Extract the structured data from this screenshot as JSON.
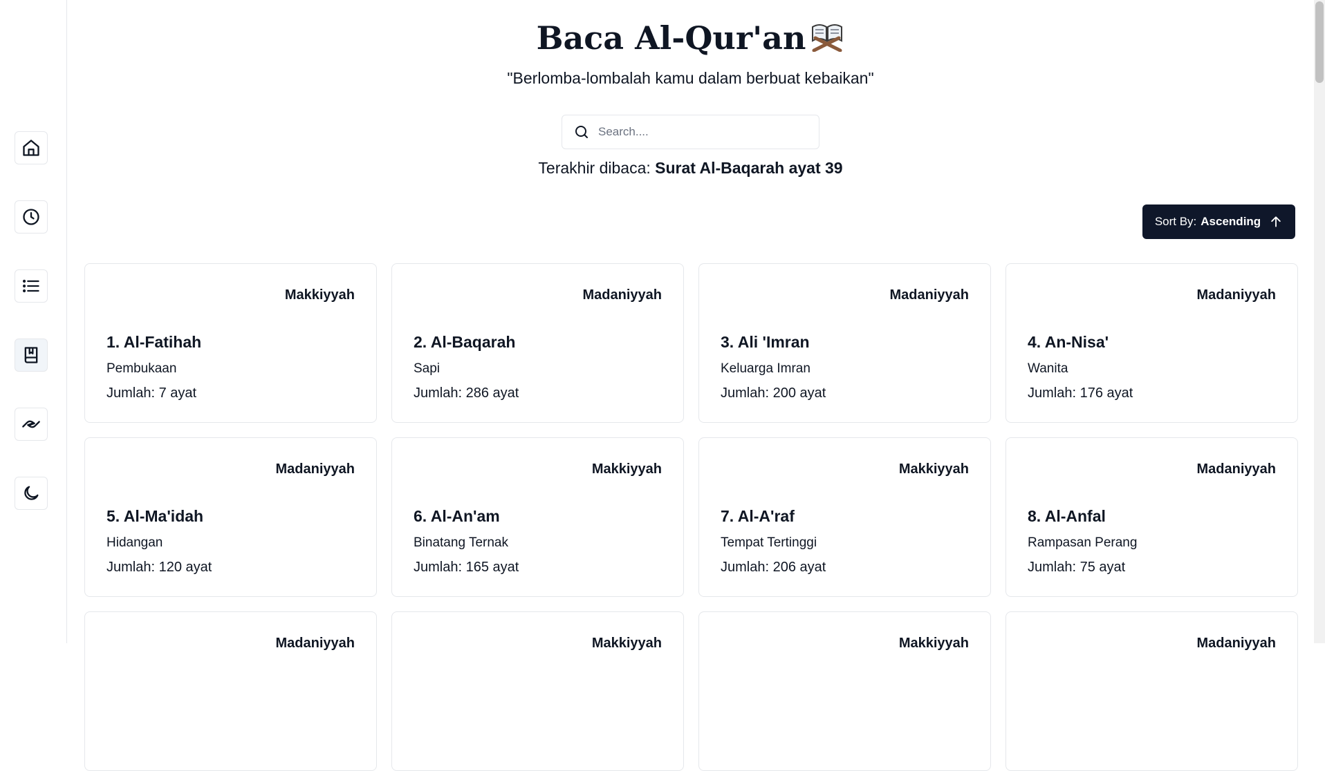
{
  "header": {
    "title": "Baca Al-Qur'an",
    "subtitle": "\"Berlomba-lombalah kamu dalam berbuat kebaikan\""
  },
  "search": {
    "placeholder": "Search...."
  },
  "last_read": {
    "label": "Terakhir dibaca:",
    "value": "Surat Al-Baqarah ayat 39"
  },
  "sort": {
    "label": "Sort By:",
    "value": "Ascending"
  },
  "sidebar": {
    "items": [
      {
        "name": "home",
        "icon": "home-icon"
      },
      {
        "name": "history",
        "icon": "clock-icon"
      },
      {
        "name": "list",
        "icon": "list-icon"
      },
      {
        "name": "quran",
        "icon": "book-icon",
        "active": true
      },
      {
        "name": "prayer",
        "icon": "praying-hands-icon"
      },
      {
        "name": "theme",
        "icon": "moon-icon"
      }
    ]
  },
  "surahs": [
    {
      "type": "Makkiyyah",
      "name": "1. Al-Fatihah",
      "meaning": "Pembukaan",
      "count": "Jumlah: 7 ayat"
    },
    {
      "type": "Madaniyyah",
      "name": "2. Al-Baqarah",
      "meaning": "Sapi",
      "count": "Jumlah: 286 ayat"
    },
    {
      "type": "Madaniyyah",
      "name": "3. Ali 'Imran",
      "meaning": "Keluarga Imran",
      "count": "Jumlah: 200 ayat"
    },
    {
      "type": "Madaniyyah",
      "name": "4. An-Nisa'",
      "meaning": "Wanita",
      "count": "Jumlah: 176 ayat"
    },
    {
      "type": "Madaniyyah",
      "name": "5. Al-Ma'idah",
      "meaning": "Hidangan",
      "count": "Jumlah: 120 ayat"
    },
    {
      "type": "Makkiyyah",
      "name": "6. Al-An'am",
      "meaning": "Binatang Ternak",
      "count": "Jumlah: 165 ayat"
    },
    {
      "type": "Makkiyyah",
      "name": "7. Al-A'raf",
      "meaning": "Tempat Tertinggi",
      "count": "Jumlah: 206 ayat"
    },
    {
      "type": "Madaniyyah",
      "name": "8. Al-Anfal",
      "meaning": "Rampasan Perang",
      "count": "Jumlah: 75 ayat"
    },
    {
      "type": "Madaniyyah",
      "name": "",
      "meaning": "",
      "count": ""
    },
    {
      "type": "Makkiyyah",
      "name": "",
      "meaning": "",
      "count": ""
    },
    {
      "type": "Makkiyyah",
      "name": "",
      "meaning": "",
      "count": ""
    },
    {
      "type": "Madaniyyah",
      "name": "",
      "meaning": "",
      "count": ""
    }
  ],
  "colors": {
    "primary": "#0f172a",
    "border": "#e5e7eb",
    "text": "#0f1623"
  }
}
